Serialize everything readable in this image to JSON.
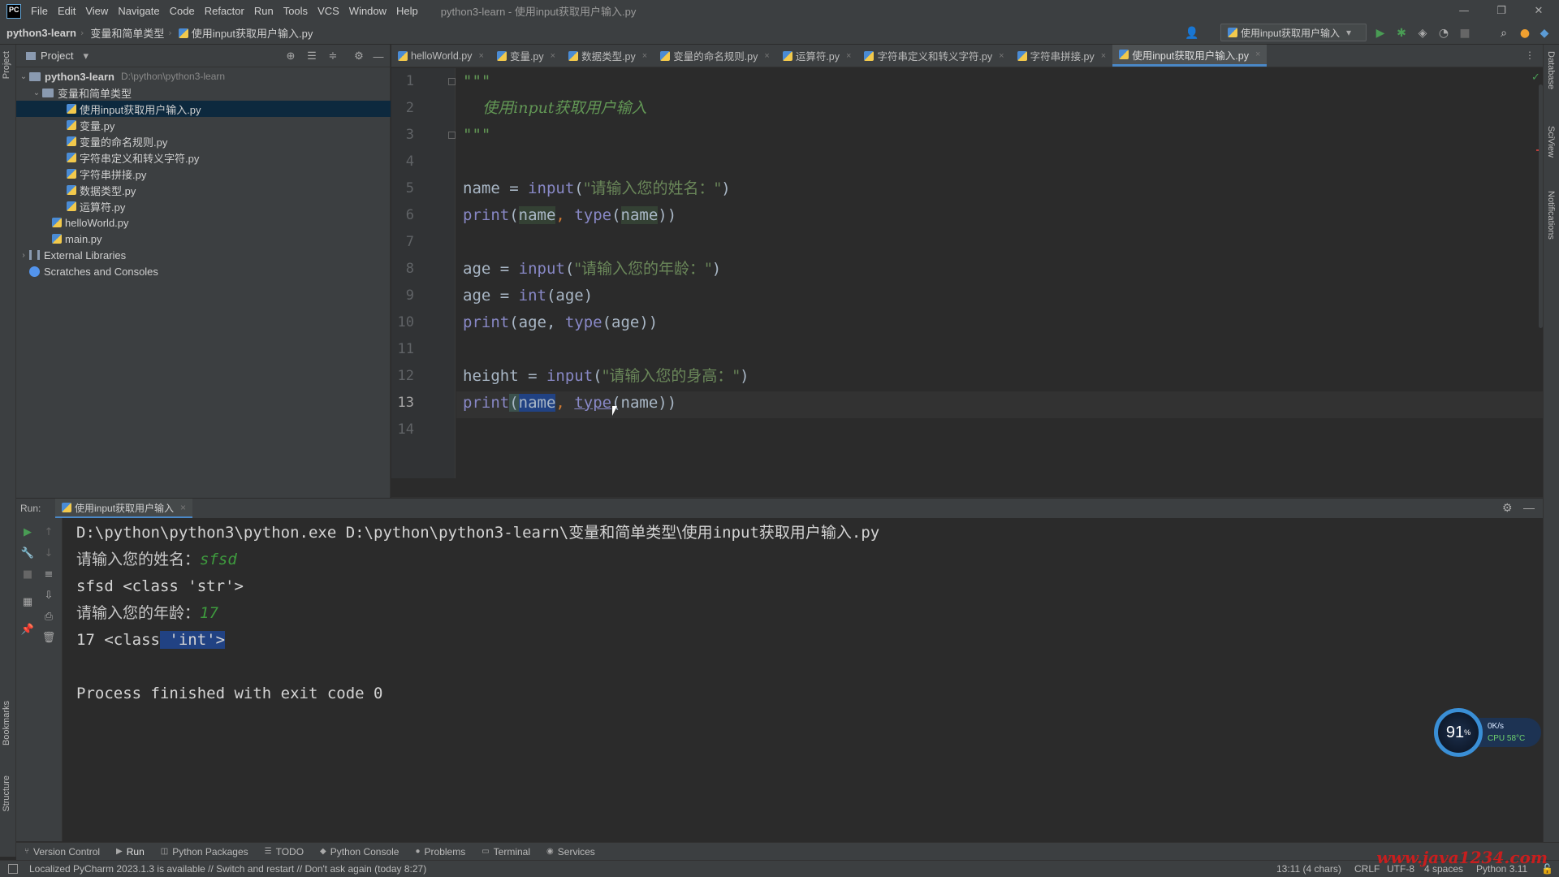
{
  "menu": {
    "logo": "PC",
    "items": [
      "File",
      "Edit",
      "View",
      "Navigate",
      "Code",
      "Refactor",
      "Run",
      "Tools",
      "VCS",
      "Window",
      "Help"
    ],
    "window_title": "python3-learn - 使用input获取用户输入.py"
  },
  "window_controls": {
    "minimize": "—",
    "restore": "❐",
    "close": "✕"
  },
  "breadcrumb": {
    "project": "python3-learn",
    "folder": "变量和简单类型",
    "file": "使用input获取用户输入.py"
  },
  "toolbar": {
    "run_config": "使用input获取用户输入",
    "dropdown": "▾"
  },
  "project_panel": {
    "title": "Project",
    "tree": [
      {
        "label": "python3-learn",
        "path": "D:\\python\\python3-learn",
        "arrow": "⌄"
      },
      {
        "label": "变量和简单类型",
        "arrow": "⌄"
      },
      {
        "label": "使用input获取用户输入.py"
      },
      {
        "label": "变量.py"
      },
      {
        "label": "变量的命名规则.py"
      },
      {
        "label": "字符串定义和转义字符.py"
      },
      {
        "label": "字符串拼接.py"
      },
      {
        "label": "数据类型.py"
      },
      {
        "label": "运算符.py"
      },
      {
        "label": "helloWorld.py"
      },
      {
        "label": "main.py"
      },
      {
        "label": "External Libraries",
        "arrow": "›"
      },
      {
        "label": "Scratches and Consoles"
      }
    ]
  },
  "editor_tabs": [
    "helloWorld.py",
    "变量.py",
    "数据类型.py",
    "变量的命名规则.py",
    "运算符.py",
    "字符串定义和转义字符.py",
    "字符串拼接.py",
    "使用input获取用户输入.py"
  ],
  "tab_close": "×",
  "line_numbers": [
    "1",
    "2",
    "3",
    "4",
    "5",
    "6",
    "7",
    "8",
    "9",
    "10",
    "11",
    "12",
    "13",
    "14"
  ],
  "code": {
    "l1": "\"\"\"",
    "l2": "    使用input获取用户输入",
    "l3": "\"\"\"",
    "l5_var": "name",
    "l5_eq": " = ",
    "l5_fn": "input",
    "l5_open": "(",
    "l5_str": "\"请输入您的姓名：\"",
    "l5_close": ")",
    "l6_fn": "print",
    "l6_open": "(",
    "l6_arg": "name",
    "l6_comma": ", ",
    "l6_type": "type",
    "l6_tail_open": "(",
    "l6_arg2": "name",
    "l6_close": "))",
    "l8_var": "age",
    "l8_eq": " = ",
    "l8_fn": "input",
    "l8_open": "(",
    "l8_str": "\"请输入您的年龄：\"",
    "l8_close": ")",
    "l9_var": "age",
    "l9_eq": " = ",
    "l9_fn": "int",
    "l9_rest": "(age)",
    "l10_fn": "print",
    "l10_rest1": "(age, ",
    "l10_type": "type",
    "l10_rest2": "(age))",
    "l12_var": "height",
    "l12_eq": " = ",
    "l12_fn": "input",
    "l12_open": "(",
    "l12_str": "\"请输入您的身高：\"",
    "l12_close": ")",
    "l13_fn": "print",
    "l13_open": "(",
    "l13_sel": "name",
    "l13_comma": ", ",
    "l13_type": "type",
    "l13_rest": "(name))"
  },
  "run_panel": {
    "label": "Run:",
    "tab": "使用input获取用户输入"
  },
  "console": {
    "cmd_prefix": "D:\\python\\python3\\python.exe D:\\python\\python3-learn\\",
    "cmd_cn1": "变量和简单类型",
    "cmd_mid": "\\使用",
    "cmd_input": "input",
    "cmd_cn2": "获取用户输入",
    "cmd_ext": ".py",
    "prompt1": "请输入您的姓名：",
    "input1": "sfsd",
    "out1": "sfsd <class 'str'>",
    "prompt2": "请输入您的年龄：",
    "input2": "17",
    "out2_pre": "17 <class",
    "out2_sel": " 'int'>",
    "exit": "Process finished with exit code 0"
  },
  "tool_tabs": [
    "Version Control",
    "Run",
    "Python Packages",
    "TODO",
    "Python Console",
    "Problems",
    "Terminal",
    "Services"
  ],
  "side_labels": {
    "project": "Project",
    "bookmarks": "Bookmarks",
    "structure": "Structure",
    "database": "Database",
    "sciview": "SciView",
    "notifications": "Notifications"
  },
  "status_bar": {
    "message": "Localized PyCharm 2023.1.3 is available // Switch and restart // Don't ask again (today 8:27)",
    "position": "13:11 (4 chars)",
    "line_sep": "CRLF",
    "encoding": "UTF-8",
    "indent": "4 spaces",
    "interpreter": "Python 3.11"
  },
  "cpu_widget": {
    "percent": "91",
    "unit": "%",
    "speed": "0K/s",
    "temp": "CPU 58°C"
  },
  "watermark": "www.java1234.com",
  "colors": {
    "accent": "#4a88c7",
    "selection": "#214283",
    "string": "#6a8759",
    "builtin": "#8888c6"
  }
}
